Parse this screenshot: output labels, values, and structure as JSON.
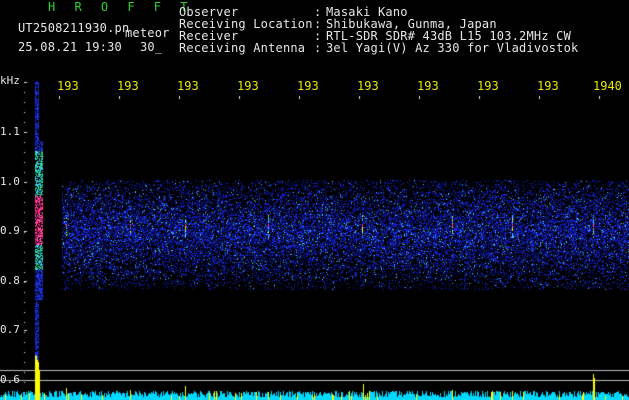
{
  "header": {
    "program": "H R O F F T",
    "file_name": "UT2508211930.pn",
    "event_type": "meteor",
    "date_time": "25.08.21 19:30",
    "interval": "30_",
    "fields": [
      {
        "label": "Observer",
        "value": "Masaki Kano"
      },
      {
        "label": "Receiving Location",
        "value": "Shibukawa, Gunma, Japan"
      },
      {
        "label": "Receiver",
        "value": "RTL-SDR SDR# 43dB L15 103.2MHz CW"
      },
      {
        "label": "Receiving Antenna",
        "value": "3el Yagi(V) Az 330 for Vladivostok"
      }
    ],
    "separator": ":"
  },
  "y_axis": {
    "unit": "kHz",
    "ticks": [
      "1.1",
      "1.0",
      "0.9",
      "0.8",
      "0.7",
      "0.6"
    ]
  },
  "x_axis": {
    "ticks": [
      "193",
      "193",
      "193",
      "193",
      "193",
      "193",
      "193",
      "193",
      "193",
      "1940"
    ]
  },
  "colors": {
    "background": "#000000",
    "text": "#e6e6e6",
    "title": "#2fd12f",
    "time_ticks": "#e8e800",
    "noise_low": "#1a1ad6",
    "baseline": "#00d8ff",
    "echo": "#ffff00",
    "echo_hot": "#ff2a8a"
  }
}
